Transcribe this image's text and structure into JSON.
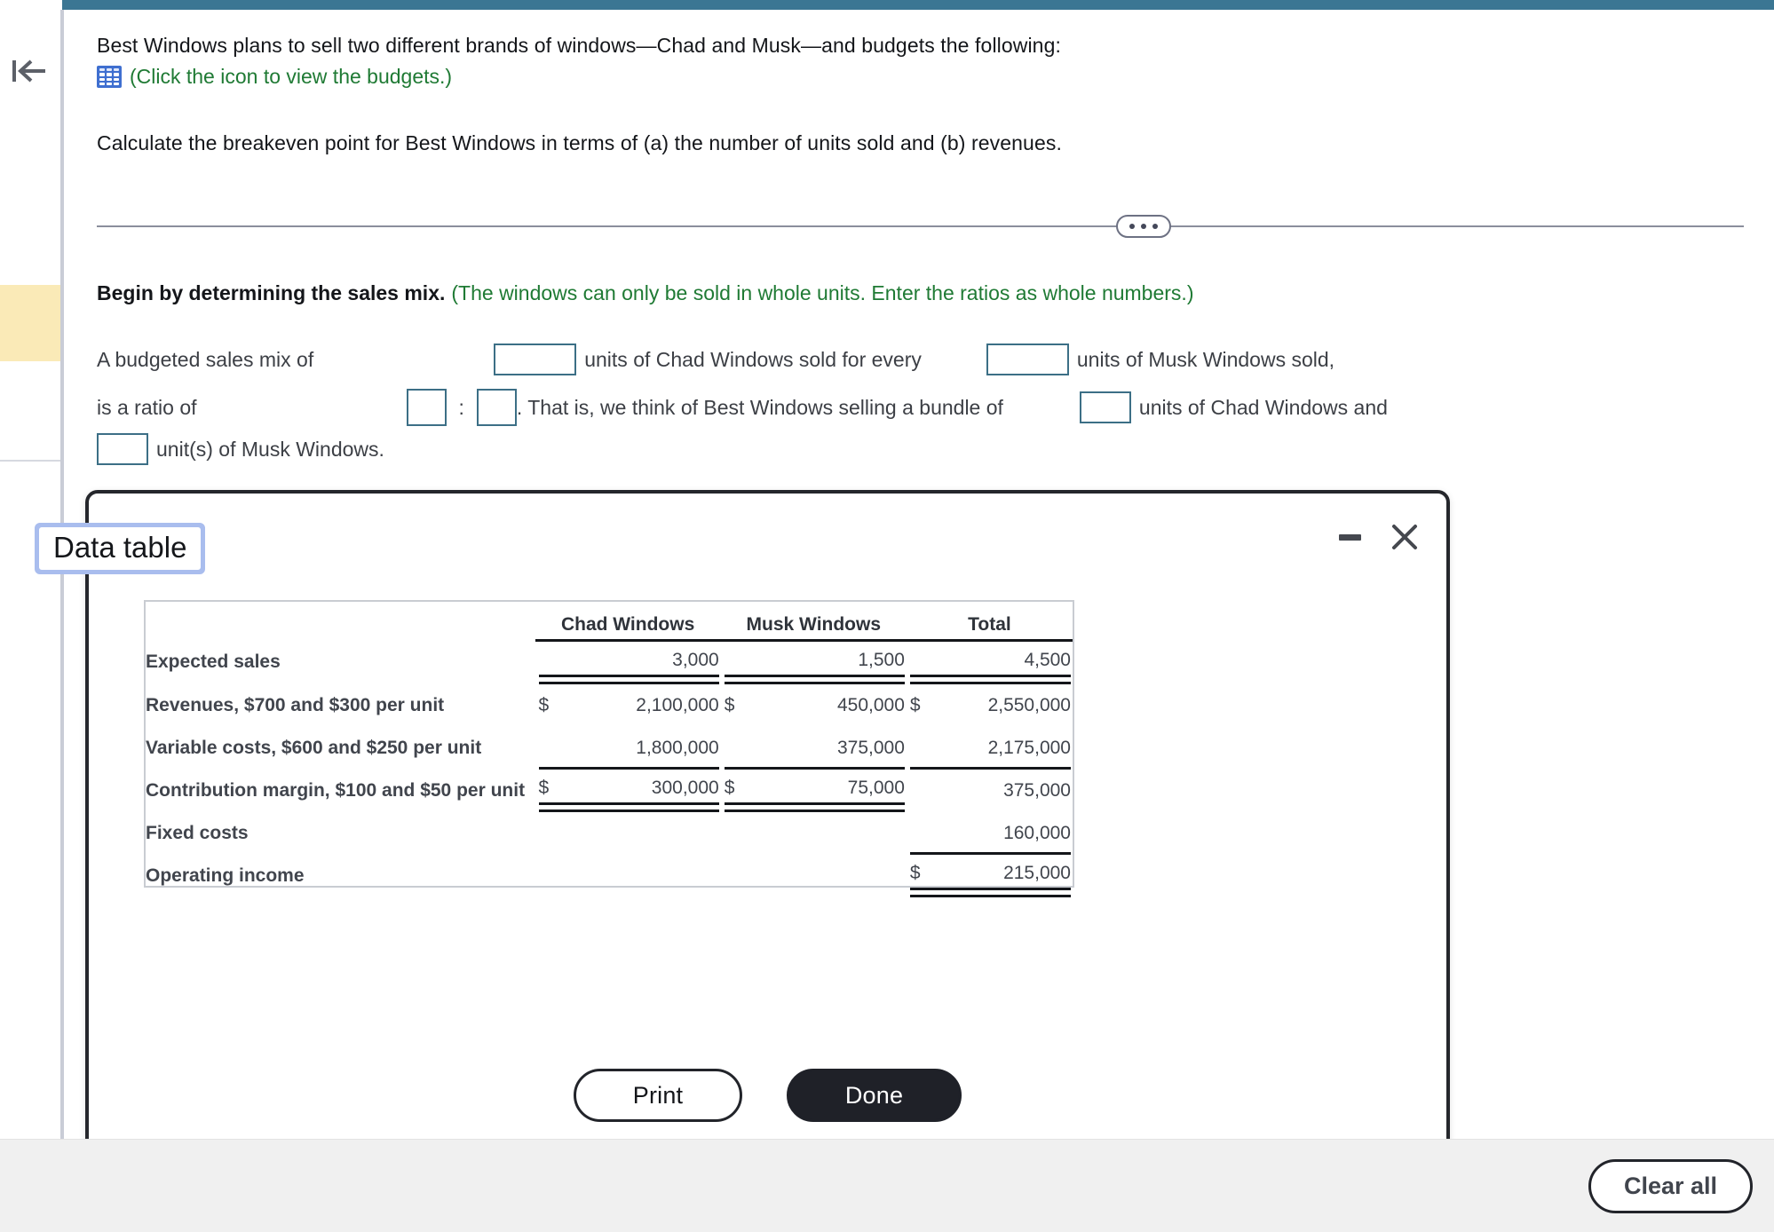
{
  "problem": {
    "paragraph_1": "Best Windows plans to sell two different brands of windows—Chad and Musk—and budgets the following:",
    "icon_link": "(Click the icon to view the budgets.)",
    "paragraph_2": "Calculate the breakeven point for Best Windows in terms of (a) the number of units sold and (b) revenues.",
    "grid_icon_name": "spreadsheet-icon"
  },
  "sales_mix": {
    "prompt_bold": "Begin by determining the sales mix.",
    "prompt_green": "(The windows can only be sold in whole units. Enter the ratios as whole numbers.)",
    "line1_a": "A budgeted sales mix of",
    "line1_b": "units of Chad Windows sold for every",
    "line1_c": "units of Musk Windows sold,",
    "line2_a": "is a ratio of",
    "line2_colon": ":",
    "line2_b": ". That is, we think of Best Windows selling a bundle of",
    "line2_c": "units of Chad Windows and",
    "line3_a": "unit(s) of Musk Windows.",
    "inputs": {
      "chad_units": "",
      "musk_units": "",
      "ratio_left": "",
      "ratio_right": "",
      "bundle_chad": "",
      "bundle_musk": ""
    }
  },
  "modal": {
    "title": "Data table",
    "minimize_label": "Minimize",
    "close_label": "Close",
    "print_label": "Print",
    "done_label": "Done"
  },
  "footer": {
    "clear_all_label": "Clear all"
  },
  "sidebar": {
    "collapse_icon": "collapse-left-icon"
  },
  "colors": {
    "topbar_teal": "#3b7693",
    "link_green": "#1f7a34",
    "input_border": "#3c6f86",
    "highlight_yellow": "#faeab7",
    "focus_ring": "#a9bdee",
    "done_button": "#1f2128"
  },
  "chart_data": {
    "type": "table",
    "title": "Data table",
    "columns": [
      "",
      "Chad Windows",
      "Musk Windows",
      "Total"
    ],
    "rows": [
      {
        "label": "Expected sales",
        "chad": "3,000",
        "chad_cur": "",
        "musk": "1,500",
        "musk_cur": "",
        "total": "4,500",
        "total_cur": "",
        "rule": "double"
      },
      {
        "label": "Revenues, $700 and $300 per unit",
        "chad": "2,100,000",
        "chad_cur": "$",
        "musk": "450,000",
        "musk_cur": "$",
        "total": "2,550,000",
        "total_cur": "$",
        "rule": "none"
      },
      {
        "label": "Variable costs, $600 and $250 per unit",
        "chad": "1,800,000",
        "chad_cur": "",
        "musk": "375,000",
        "musk_cur": "",
        "total": "2,175,000",
        "total_cur": "",
        "rule": "single"
      },
      {
        "label": "Contribution margin, $100 and $50 per unit",
        "chad": "300,000",
        "chad_cur": "$",
        "musk": "75,000",
        "musk_cur": "$",
        "total": "375,000",
        "total_cur": "",
        "rule": "double-chad-musk"
      },
      {
        "label": "Fixed costs",
        "chad": "",
        "chad_cur": "",
        "musk": "",
        "musk_cur": "",
        "total": "160,000",
        "total_cur": "",
        "rule": "single-total"
      },
      {
        "label": "Operating income",
        "chad": "",
        "chad_cur": "",
        "musk": "",
        "musk_cur": "",
        "total": "215,000",
        "total_cur": "$",
        "rule": "double-total"
      }
    ]
  }
}
